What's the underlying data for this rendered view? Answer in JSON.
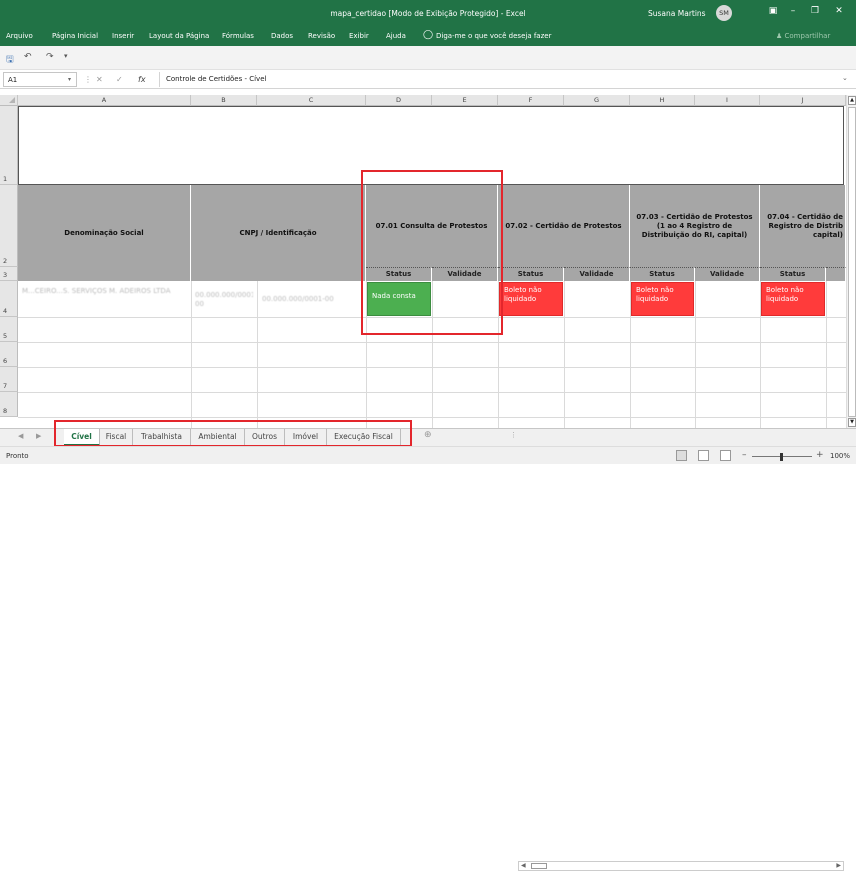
{
  "window": {
    "title": "mapa_certidao  [Modo de Exibição Protegido]  -  Excel",
    "user": "Susana Martins",
    "initials": "SM"
  },
  "ribbon": {
    "tabs": [
      "Arquivo",
      "Página Inicial",
      "Inserir",
      "Layout da Página",
      "Fórmulas",
      "Dados",
      "Revisão",
      "Exibir",
      "Ajuda"
    ],
    "tell_me": "Diga-me o que você deseja fazer",
    "share": "Compartilhar"
  },
  "formula_bar": {
    "name_box": "A1",
    "fx": "fx",
    "content": "Controle de Certidões - Cível"
  },
  "columns": [
    "A",
    "B",
    "C",
    "D",
    "E",
    "F",
    "G",
    "H",
    "I",
    "J"
  ],
  "rows": [
    "1",
    "2",
    "3",
    "4",
    "5",
    "6",
    "7",
    "8"
  ],
  "headers": {
    "denominacao": "Denominação Social",
    "cnpj": "CNPJ / Identificação",
    "c0701": "07.01 Consulta de Protestos",
    "c0702": "07.02 -  Certidão de Protestos",
    "c0703": "07.03 -  Certidão de Protestos (1 ao 4 Registro de Distribuição do RI, capital)",
    "c0704": "07.04 - Certidão de Registro de Distrib capital)",
    "status": "Status",
    "validade": "Validade"
  },
  "row4": {
    "company": "M...CEIRO...S. SERVIÇOS M. ADEIROS LTDA",
    "cnpj_b": "00.000.000/0001-00",
    "cnpj_c": "00.000.000/0001-00",
    "d": "Nada consta",
    "f": "Boleto não liquidado",
    "h": "Boleto não liquidado",
    "j": "Boleto não liquidado"
  },
  "colors": {
    "excel_green": "#217346",
    "ok": "#4caf50",
    "bad": "#ff3b3b",
    "header_gray": "#a6a6a6",
    "highlight": "#e3262c"
  },
  "sheet_tabs": [
    "Cível",
    "Fiscal",
    "Trabalhista",
    "Ambiental",
    "Outros",
    "Imóvel",
    "Execução Fiscal"
  ],
  "active_tab": "Cível",
  "status_bar": {
    "ready": "Pronto",
    "zoom": "100%"
  }
}
